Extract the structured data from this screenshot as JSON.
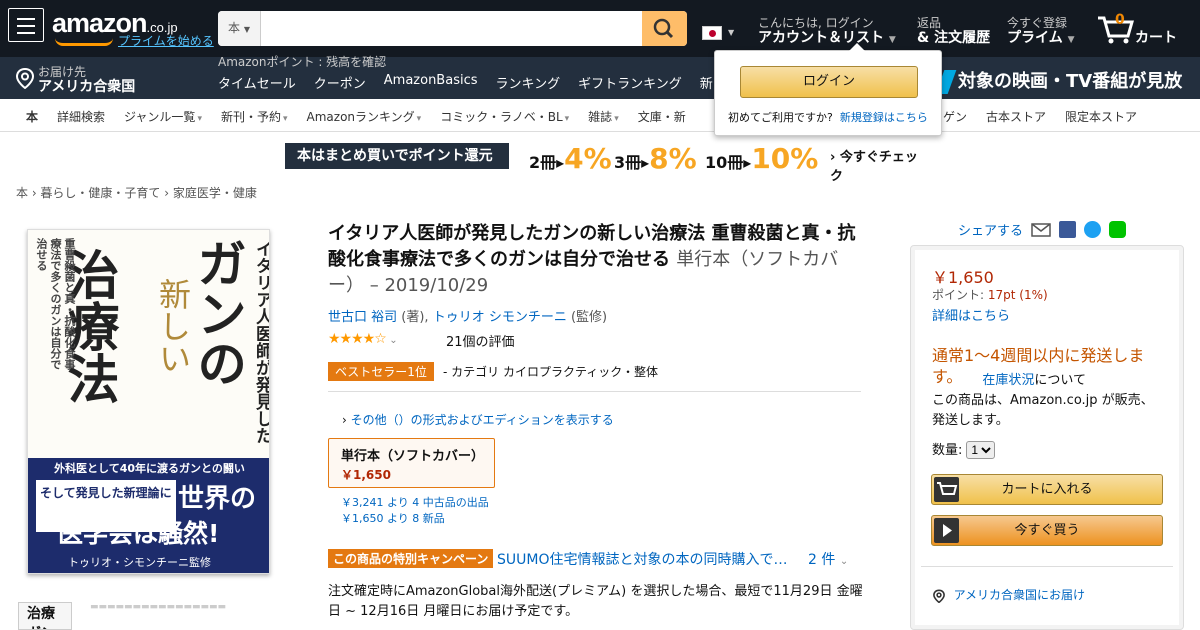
{
  "header": {
    "logo_text": "amazon",
    "logo_suffix": ".co.jp",
    "prime_link": "プライムを始める",
    "search_category": "本",
    "search_placeholder": "",
    "greeting": "こんにちは, ログイン",
    "account_label": "アカウント＆リスト",
    "returns_small": "返品",
    "returns_label": "& 注文履歴",
    "prime_small": "今すぐ登録",
    "prime_label": "プライム",
    "cart_count": "0",
    "cart_label": "カート"
  },
  "subnav": {
    "deliver_small": "お届け先",
    "deliver_country": "アメリカ合衆国",
    "points_text": "Amazonポイント : 残高を確認",
    "links": [
      "タイムセール",
      "クーポン",
      "AmazonBasics",
      "ランキング",
      "ギフトランキング",
      "新"
    ],
    "promo": "対象の映画・TV番組が見放題"
  },
  "signin_popup": {
    "button": "ログイン",
    "new_text": "初めてご利用ですか?",
    "new_link": "新規登録はこちら"
  },
  "categories": [
    "本",
    "詳細検索",
    "ジャンル一覧",
    "新刊・予約",
    "Amazonランキング",
    "コミック・ラノベ・BL",
    "雑誌",
    "文庫・新",
    "ゲン",
    "古本ストア",
    "限定本ストア"
  ],
  "banner": {
    "left_text": "本はまとめ買いでポイント還元",
    "deals": [
      {
        "qty": "2冊",
        "pct": "4%"
      },
      {
        "qty": "3冊",
        "pct": "8%"
      },
      {
        "qty": "10冊",
        "pct": "10%"
      }
    ],
    "cta": "今すぐチェック"
  },
  "breadcrumb": "本 › 暮らし・健康・子育て › 家庭医学・健康",
  "book": {
    "title": "イタリア人医師が発見したガンの新しい治療法 重曹殺菌と真・抗酸化食事療法で多くのガンは自分で治せる",
    "format_date": "単行本（ソフトカバー） – 2019/10/29",
    "author1": "世古口 裕司",
    "author1_role": "(著),",
    "author2": "トゥリオ シモンチーニ",
    "author2_role": "(監修)",
    "rating": "4.3",
    "review_count": "21個の評価",
    "bestseller_badge": "ベストセラー1位",
    "bestseller_category": "- カテゴリ カイロプラクティック・整体",
    "other_formats": "その他（）の形式およびエディションを表示する",
    "format_name": "単行本（ソフトカバー）",
    "format_price": "￥1,650",
    "used_offer": "￥3,241 より 4 中古品の出品",
    "new_offer": "￥1,650 より 8 新品",
    "campaign_badge": "この商品の特別キャンペーン",
    "campaign_text": "SUUMO住宅情報誌と対象の本の同時購入で…",
    "campaign_count": "2 件",
    "shipping_text": "注文確定時にAmazonGlobal海外配送(プレミアム) を選択した場合、最短で11月29日 金曜日 ~ 12月16日 月曜日にお届け予定です。",
    "cover": {
      "side_text": "イタリア人医師が発見した",
      "title_big": "ガンの",
      "title_mid": "新しい",
      "title_main": "治療法",
      "sub_text": "重曹殺菌と真・抗酸化食事療法で多くのガンは自分で治せる",
      "band_top": "外科医として40年に渡るガンとの闘い",
      "band_mid": "そして発見した新理論に",
      "band_big1": "世界の",
      "band_big2": "医学会は騒然!",
      "band_bottom": "トゥリオ・シモンチーニ監修"
    }
  },
  "share": {
    "label": "シェアする"
  },
  "buybox": {
    "price": "￥1,650",
    "points_label": "ポイント:",
    "points_value": "17pt (1%)",
    "details_link": "詳細はこちら",
    "availability": "通常1～4週間以内に発送します。",
    "stock_link": "在庫状況",
    "stock_suffix": "について",
    "sold_by": "この商品は、Amazon.co.jp が販売、発送します。",
    "qty_label": "数量:",
    "qty_value": "1",
    "add_to_cart": "カートに入れる",
    "buy_now": "今すぐ買う",
    "deliver_to": "アメリカ合衆国にお届け"
  },
  "colors": {
    "header": "#131921",
    "subheader": "#232f3e",
    "accent": "#febd69",
    "orange": "#e47911",
    "link": "#0066c0",
    "price": "#b12704"
  }
}
